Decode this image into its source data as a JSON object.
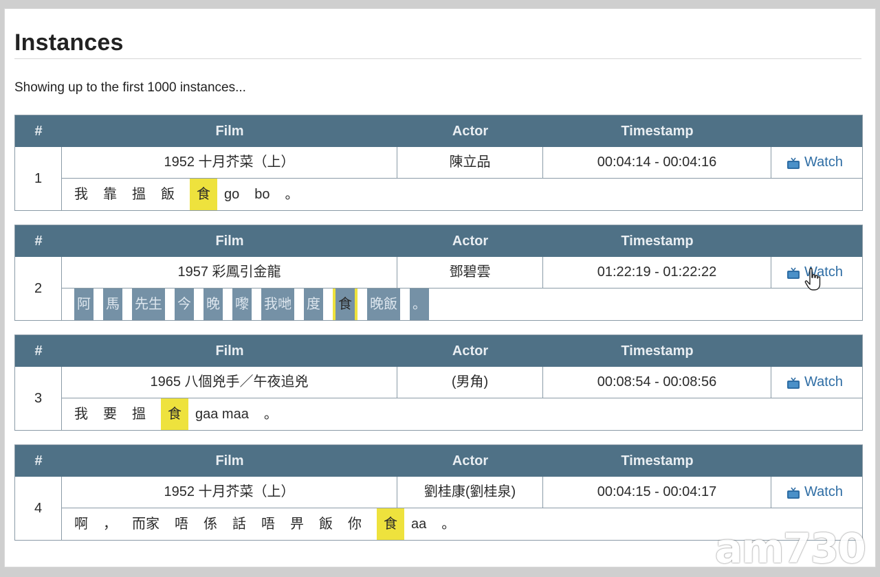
{
  "page": {
    "title": "Instances",
    "subtitle": "Showing up to the first 1000 instances..."
  },
  "headers": {
    "num": "#",
    "film": "Film",
    "actor": "Actor",
    "timestamp": "Timestamp"
  },
  "watch_label": "Watch",
  "instances": [
    {
      "num": "1",
      "film": "1952 十月芥菜（上）",
      "actor": "陳立品",
      "timestamp": "00:04:14 - 00:04:16",
      "tokens": [
        "我",
        "靠",
        "搵",
        "飯",
        "食",
        "go",
        "bo",
        "。"
      ],
      "highlight": "食"
    },
    {
      "num": "2",
      "film": "1957 彩鳳引金龍",
      "actor": "鄧碧雲",
      "timestamp": "01:22:19 - 01:22:22",
      "tokens": [
        "阿",
        "馬",
        "先生",
        "今",
        "晚",
        "嚟",
        "我哋",
        "度",
        "食",
        "晚飯",
        "。"
      ],
      "highlight": "食"
    },
    {
      "num": "3",
      "film": "1965 八個兇手／午夜追兇",
      "actor": "(男角)",
      "timestamp": "00:08:54 - 00:08:56",
      "tokens": [
        "我",
        "要",
        "搵",
        "食",
        "gaa maa",
        "。"
      ],
      "highlight": "食"
    },
    {
      "num": "4",
      "film": "1952 十月芥菜（上）",
      "actor": "劉桂康(劉桂泉)",
      "timestamp": "00:04:15 - 00:04:17",
      "tokens": [
        "啊",
        "，",
        "而家",
        "唔",
        "係",
        "話",
        "唔",
        "畀",
        "飯",
        "你",
        "食",
        "aa",
        "。"
      ],
      "highlight": "食"
    }
  ],
  "watermark": "am730",
  "colors": {
    "header_bg": "#4f7186",
    "highlight": "#eee23d",
    "selection": "#7591a6",
    "link": "#2e6da4"
  },
  "icons": {
    "watch": "tv-icon",
    "cursor": "hand-pointer-icon"
  }
}
